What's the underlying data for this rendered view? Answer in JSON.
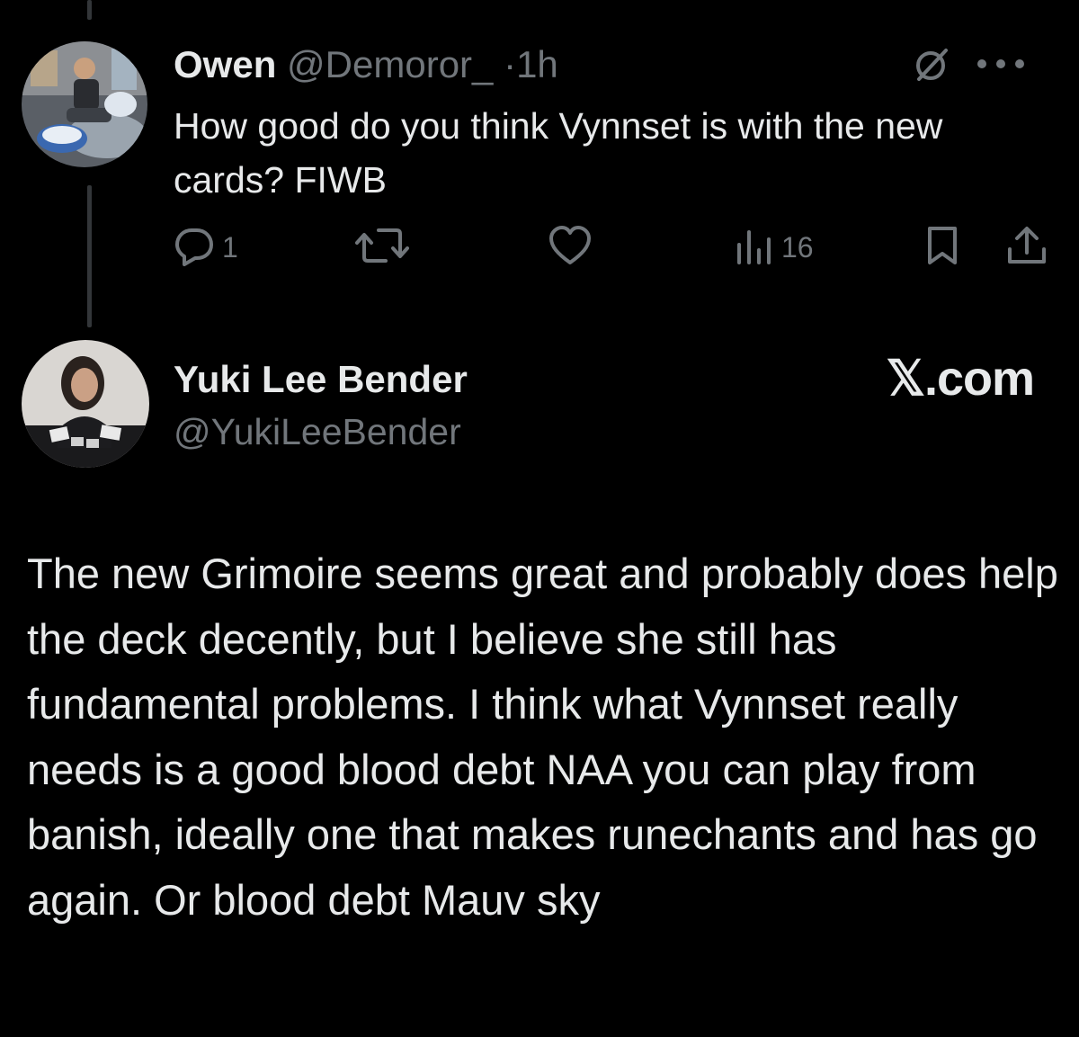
{
  "parent_tweet": {
    "name": "Owen",
    "handle": "@Demoror_",
    "separator": "·",
    "time": "1h",
    "text": "How good do you think Vynnset is with the new cards? FIWB",
    "actions": {
      "reply_count": "1",
      "retweet_count": "",
      "like_count": "",
      "views_count": "16"
    }
  },
  "quote_tweet": {
    "name": "Yuki Lee Bender",
    "handle": "@YukiLeeBender",
    "brand": "𝕏.com",
    "text": "The new Grimoire seems great and probably does help the deck decently, but I believe she still has fundamental problems. I think what Vynnset really needs is a good blood debt NAA you can play from banish, ideally one that makes runechants and has go again. Or blood debt Mauv sky"
  },
  "icons": [
    "reply-icon",
    "retweet-icon",
    "like-icon",
    "views-icon",
    "bookmark-icon",
    "share-icon",
    "grok-icon",
    "more-icon"
  ],
  "colors": {
    "background": "#000000",
    "primary_text": "#e7e9ea",
    "secondary_text": "#71767b",
    "thread_line": "#333639"
  }
}
